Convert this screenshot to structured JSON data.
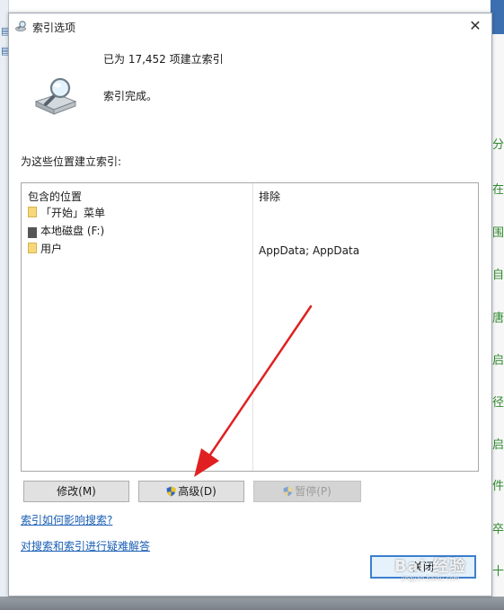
{
  "dialog": {
    "title": "索引选项",
    "close_glyph": "✕",
    "count_text": "已为 17,452 项建立索引",
    "status_text": "索引完成。",
    "section_label": "为这些位置建立索引:"
  },
  "table": {
    "headers": {
      "included": "包含的位置",
      "excluded": "排除"
    },
    "rows": [
      {
        "label": "「开始」菜单",
        "icon": "folder-icon",
        "exclude": ""
      },
      {
        "label": "本地磁盘 (F:)",
        "icon": "drive-icon",
        "exclude": ""
      },
      {
        "label": "用户",
        "icon": "folder-icon",
        "exclude": "AppData; AppData"
      }
    ]
  },
  "buttons": {
    "modify": "修改(M)",
    "advanced": "高级(D)",
    "pause": "暂停(P)",
    "close": "关闭"
  },
  "links": {
    "how_indexing": "索引如何影响搜索?",
    "troubleshoot": "对搜索和索引进行疑难解答"
  },
  "watermark": {
    "main": "Bai 经验",
    "sub": "jingyan.baidu.com"
  },
  "background": {
    "right_chars": [
      "分",
      "在",
      "围",
      "自",
      "唐",
      "启",
      "径",
      "启",
      "件",
      "卒",
      "十"
    ]
  },
  "colors": {
    "accent": "#3c7fcf",
    "link": "#1a5fb4",
    "arrow": "#e02020",
    "folder": "#f6d77a"
  }
}
